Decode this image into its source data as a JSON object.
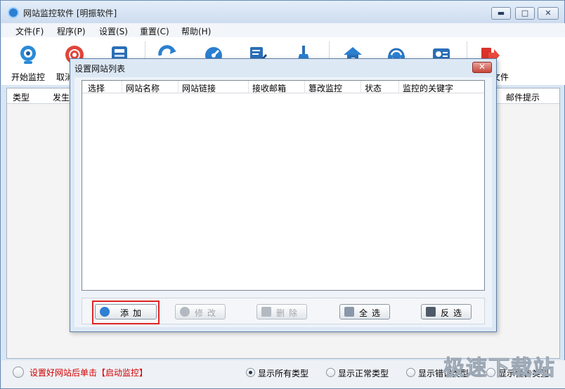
{
  "window": {
    "title": "网站监控软件 [明振软件]",
    "min_symbol": "▬",
    "max_symbol": "□",
    "close_symbol": "✕"
  },
  "menu": [
    "文件(F)",
    "程序(P)",
    "设置(S)",
    "重置(C)",
    "帮助(H)"
  ],
  "toolbar": {
    "start_label": "开始监控",
    "cancel_label": "取消",
    "export_label": "文件"
  },
  "grid": {
    "headers": [
      "类型",
      "发生",
      "邮件提示"
    ]
  },
  "status": {
    "hint": "设置好网站后单击【启动监控】",
    "radios": [
      "显示所有类型",
      "显示正常类型",
      "显示错误类型",
      "显示警告类型"
    ]
  },
  "dialog": {
    "title": "设置网站列表",
    "close_symbol": "✕",
    "columns": [
      "选择",
      "网站名称",
      "网站链接",
      "接收邮箱",
      "篡改监控",
      "状态",
      "监控的关键字"
    ],
    "buttons": {
      "add": "添加",
      "edit": "修改",
      "delete": "删除",
      "select_all": "全选",
      "invert": "反选"
    }
  },
  "watermark": "极速下载站",
  "colors": {
    "accent_red": "#e02424",
    "window_blue": "#d9e6f4",
    "hint_red": "#d40000"
  }
}
